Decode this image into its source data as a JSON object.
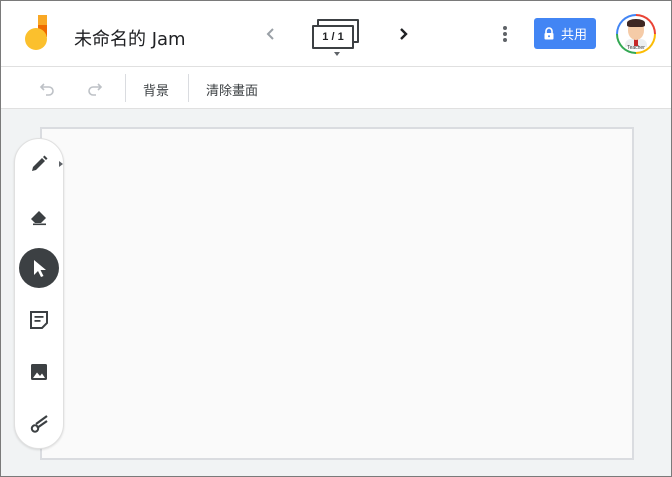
{
  "header": {
    "title": "未命名的 Jam",
    "frame_indicator": "1 / 1",
    "share_label": "共用",
    "avatar_label": "Teacher"
  },
  "toolbar": {
    "background_label": "背景",
    "clear_label": "清除畫面"
  },
  "tools": [
    {
      "name": "pen",
      "icon": "pen-icon",
      "selected": false
    },
    {
      "name": "eraser",
      "icon": "eraser-icon",
      "selected": false
    },
    {
      "name": "select",
      "icon": "cursor-icon",
      "selected": true
    },
    {
      "name": "sticky-note",
      "icon": "sticky-note-icon",
      "selected": false
    },
    {
      "name": "image",
      "icon": "image-icon",
      "selected": false
    },
    {
      "name": "laser",
      "icon": "laser-icon",
      "selected": false
    }
  ],
  "colors": {
    "share_button": "#4285f4",
    "selected_tool": "#3c4043",
    "logo_yellow": "#fbc02d",
    "logo_orange": "#ef6c00"
  }
}
